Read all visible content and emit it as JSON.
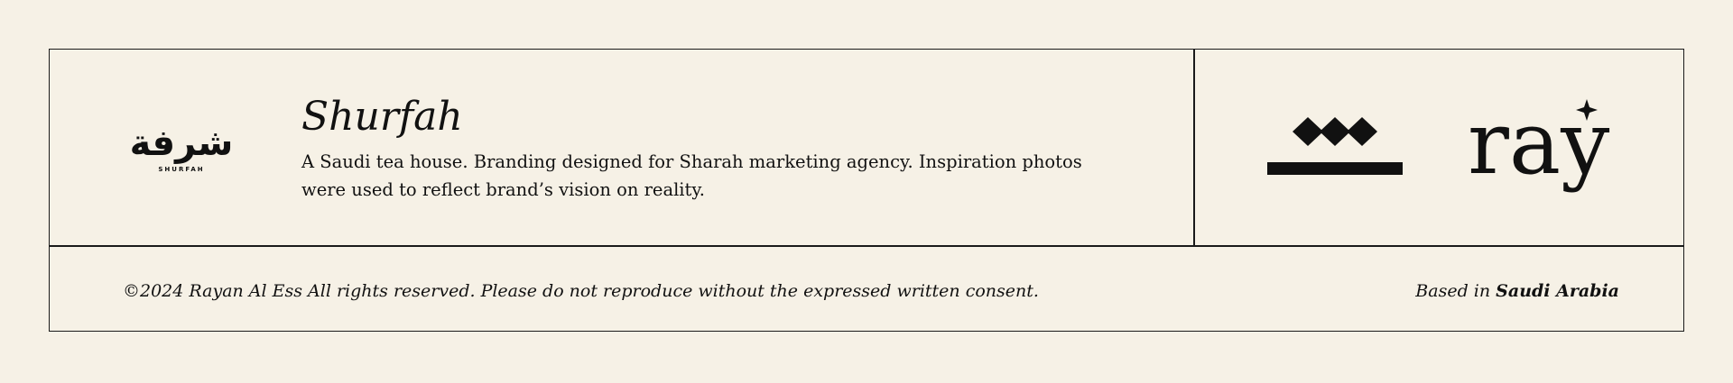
{
  "project": {
    "logo_text": "شرفة",
    "logo_subtext": "SHURFAH",
    "title": "Shurfah",
    "description": "A Saudi tea house. Branding designed for Sharah marketing agency. Inspiration photos were used to reflect brand’s vision on reality."
  },
  "brand": {
    "wordmark": "ray"
  },
  "footer": {
    "copyright": "©2024 Rayan Al Ess All rights reserved. Please do not reproduce without the expressed written consent.",
    "location_prefix": "Based in",
    "location": "Saudi Arabia"
  },
  "colors": {
    "background": "#f6f1e6",
    "ink": "#111111"
  }
}
